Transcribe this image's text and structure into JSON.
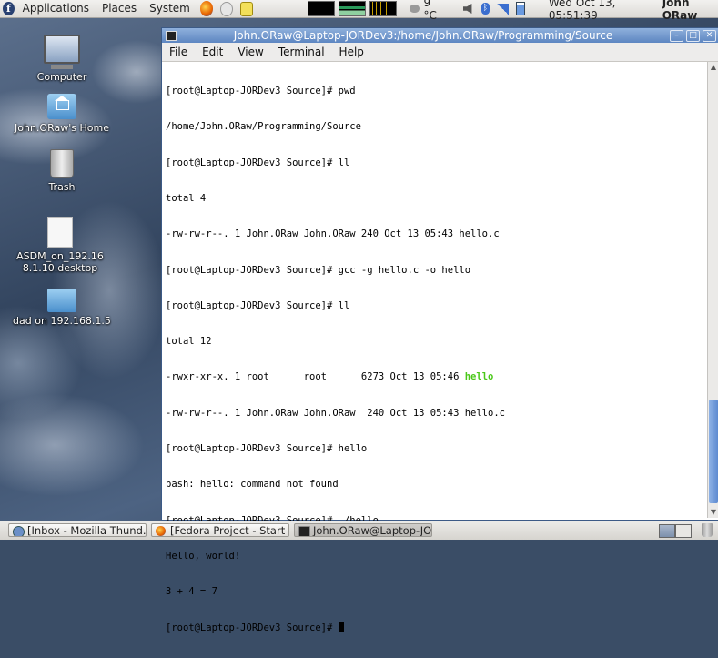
{
  "top_panel": {
    "menus": [
      "Applications",
      "Places",
      "System"
    ],
    "temperature": "9 °C",
    "clock": "Wed Oct 13, 05:51:39",
    "user": "John ORaw"
  },
  "desktop_icons": [
    {
      "label": "Computer"
    },
    {
      "label": "John.ORaw's Home"
    },
    {
      "label": "Trash"
    },
    {
      "label": "ASDM_on_192.168.1.10.desktop"
    },
    {
      "label": "dad on 192.168.1.5"
    }
  ],
  "window": {
    "title": "John.ORaw@Laptop-JORDev3:/home/John.ORaw/Programming/Source",
    "menu": [
      "File",
      "Edit",
      "View",
      "Terminal",
      "Help"
    ]
  },
  "terminal": {
    "lines": [
      "[root@Laptop-JORDev3 Source]# pwd",
      "/home/John.ORaw/Programming/Source",
      "[root@Laptop-JORDev3 Source]# ll",
      "total 4",
      "-rw-rw-r--. 1 John.ORaw John.ORaw 240 Oct 13 05:43 hello.c",
      "[root@Laptop-JORDev3 Source]# gcc -g hello.c -o hello",
      "[root@Laptop-JORDev3 Source]# ll",
      "total 12",
      "-rwxr-xr-x. 1 root      root      6273 Oct 13 05:46 ",
      "-rw-rw-r--. 1 John.ORaw John.ORaw  240 Oct 13 05:43 hello.c",
      "[root@Laptop-JORDev3 Source]# hello",
      "bash: hello: command not found",
      "[root@Laptop-JORDev3 Source]# ./hello",
      "Hello, world!",
      "3 + 4 = 7",
      "[root@Laptop-JORDev3 Source]# "
    ],
    "executable_name": "hello",
    "executable_color": "#4bc81a"
  },
  "taskbar": {
    "tasks": [
      {
        "label": "[Inbox - Mozilla Thund..."
      },
      {
        "label": "[Fedora Project - Start ..."
      },
      {
        "label": "John.ORaw@Laptop-JO..."
      }
    ]
  }
}
